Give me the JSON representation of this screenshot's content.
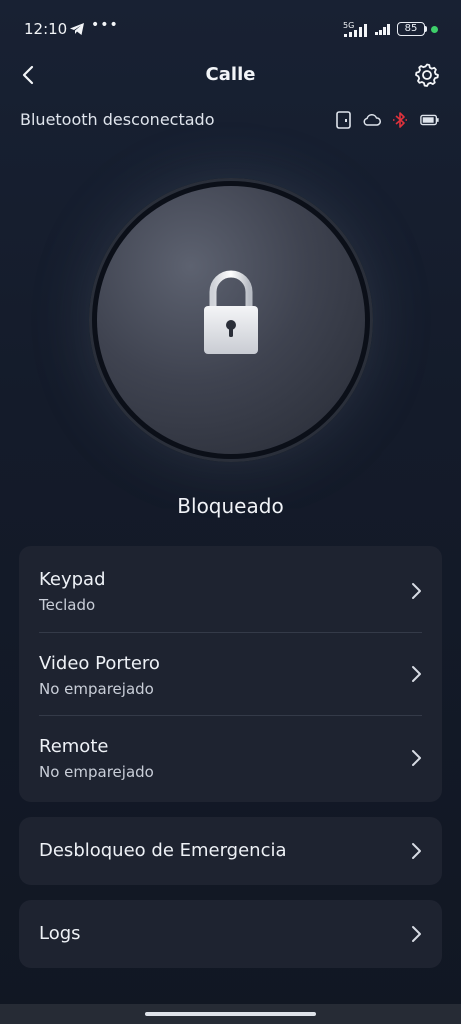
{
  "status_bar": {
    "time": "12:10",
    "network": "5G",
    "battery": "85",
    "icons": [
      "telegram-icon",
      "more-dots-icon",
      "signal-5g-icon",
      "signal-icon",
      "battery-icon",
      "green-dot"
    ]
  },
  "header": {
    "title": "Calle",
    "back_icon": "chevron-left-icon",
    "settings_icon": "gear-icon"
  },
  "connection": {
    "text": "Bluetooth desconectado",
    "icons": [
      "door-icon",
      "cloud-icon",
      "bluetooth-off-icon",
      "battery-icon"
    ],
    "bluetooth_color": "#e0323c"
  },
  "lock": {
    "status": "Bloqueado",
    "icon": "padlock-icon"
  },
  "menu": {
    "group1": [
      {
        "title": "Keypad",
        "subtitle": "Teclado"
      },
      {
        "title": "Video Portero",
        "subtitle": "No emparejado"
      },
      {
        "title": "Remote",
        "subtitle": "No emparejado"
      }
    ],
    "emergency": {
      "title": "Desbloqueo de Emergencia"
    },
    "logs": {
      "title": "Logs"
    }
  },
  "colors": {
    "background": "#141b2a",
    "card": "#1e2330",
    "accent_red": "#e0323c"
  }
}
